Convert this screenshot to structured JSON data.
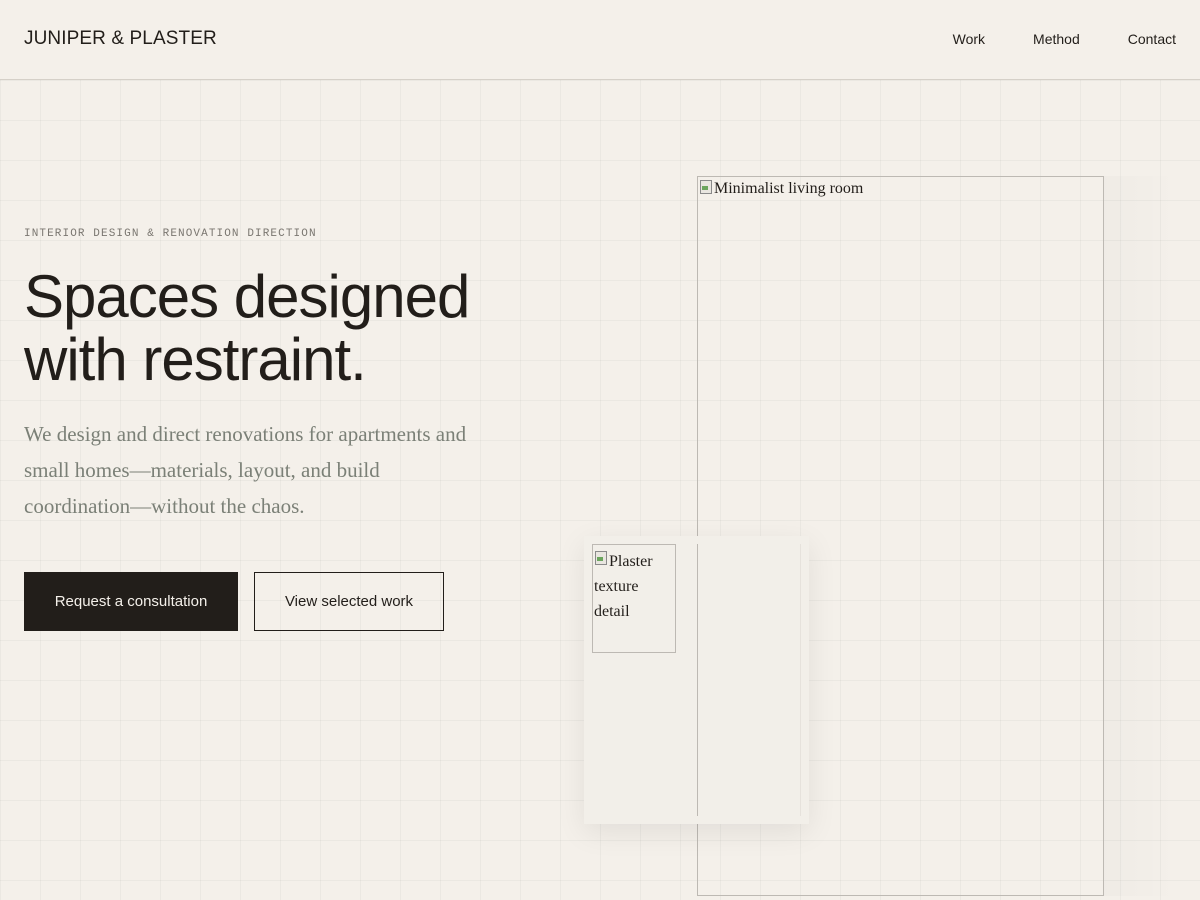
{
  "header": {
    "brand": "JUNIPER & PLASTER",
    "nav": [
      {
        "label": "Work"
      },
      {
        "label": "Method"
      },
      {
        "label": "Contact"
      }
    ]
  },
  "hero": {
    "eyebrow": "INTERIOR DESIGN & RENOVATION DIRECTION",
    "headline_line1": "Spaces designed",
    "headline_line2": "with restraint.",
    "lede": "We design and direct renovations for apartments and small homes—materials, layout, and build coordination—without the chaos.",
    "primary_cta": "Request a consultation",
    "secondary_cta": "View selected work"
  },
  "images": {
    "main_alt": "Minimalist living room",
    "detail_alt": "Plaster texture detail"
  },
  "colors": {
    "background": "#f4f0ea",
    "ink": "#221e1a",
    "muted_text": "#7b8077",
    "eyebrow": "#7a7670",
    "border": "#bdb9b3"
  },
  "icons": [
    "broken-image-icon"
  ]
}
